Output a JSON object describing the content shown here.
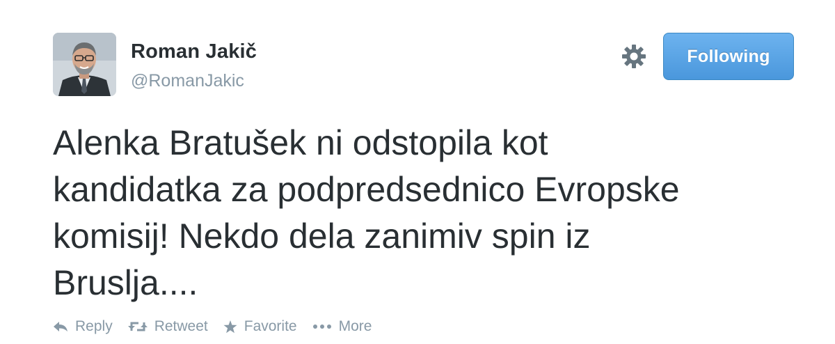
{
  "user": {
    "display_name": "Roman Jakič",
    "screen_name": "@RomanJakic",
    "avatar_icon": "user-avatar-photo"
  },
  "header": {
    "settings_icon": "gear-icon",
    "follow_button_label": "Following"
  },
  "tweet": {
    "text": "Alenka Bratušek ni odstopila kot\nkandidatka za podpredsednico Evropske\nkomisij! Nekdo dela zanimiv spin iz\nBruslja...."
  },
  "actions": {
    "reply_label": "Reply",
    "retweet_label": "Retweet",
    "favorite_label": "Favorite",
    "more_label": "More"
  },
  "colors": {
    "text": "#292f33",
    "muted": "#8899a6",
    "button_blue": "#4a97dc"
  }
}
